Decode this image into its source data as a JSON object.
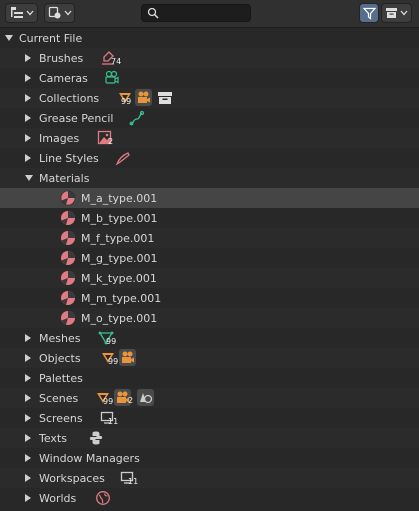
{
  "header": {
    "display_mode_icon": "outliner-display-mode-icon",
    "filter_icon": "filter-funnel-icon",
    "new_collection_icon": "new-collection-icon",
    "search": {
      "value": "",
      "placeholder": ""
    }
  },
  "tree": {
    "root": {
      "label": "Current File",
      "expanded": true
    },
    "items": [
      {
        "label": "Brushes",
        "icon": "brush-icon",
        "color": "#e07b83",
        "count": "74"
      },
      {
        "label": "Cameras",
        "icon": "camera-data-icon",
        "color": "#37c18d"
      },
      {
        "label": "Collections",
        "icon": "collection-icon",
        "color": "#e8953b",
        "count": "99"
      },
      {
        "label": "Grease Pencil",
        "icon": "grease-pencil-icon",
        "color": "#37c18d"
      },
      {
        "label": "Images",
        "icon": "image-icon",
        "color": "#e07b83",
        "count": "2"
      },
      {
        "label": "Line Styles",
        "icon": "line-style-icon",
        "color": "#e07b83"
      },
      {
        "label": "Materials",
        "expanded": true,
        "children": [
          {
            "label": "M_a_type.001",
            "selected": true
          },
          {
            "label": "M_b_type.001"
          },
          {
            "label": "M_f_type.001"
          },
          {
            "label": "M_g_type.001"
          },
          {
            "label": "M_k_type.001"
          },
          {
            "label": "M_m_type.001"
          },
          {
            "label": "M_o_type.001"
          }
        ]
      },
      {
        "label": "Meshes",
        "icon": "mesh-icon",
        "color": "#37c18d",
        "count": "99"
      },
      {
        "label": "Objects",
        "icon": "object-icon",
        "color": "#e8953b",
        "count": "99"
      },
      {
        "label": "Palettes"
      },
      {
        "label": "Scenes",
        "icon": "scene-icon",
        "color": "#e8953b",
        "count": "99",
        "count2": "2"
      },
      {
        "label": "Screens",
        "icon": "screen-icon",
        "color": "#cccccc",
        "count": "11"
      },
      {
        "label": "Texts",
        "icon": "text-icon",
        "color": "#cccccc"
      },
      {
        "label": "Window Managers"
      },
      {
        "label": "Workspaces",
        "icon": "workspace-icon",
        "color": "#cccccc",
        "count": "11"
      },
      {
        "label": "Worlds",
        "icon": "world-icon",
        "color": "#e07b83"
      }
    ]
  },
  "colors": {
    "background": "#282828",
    "selected_row": "#454545",
    "material_icon": "#e07b83",
    "active_button": "#566e8c"
  }
}
